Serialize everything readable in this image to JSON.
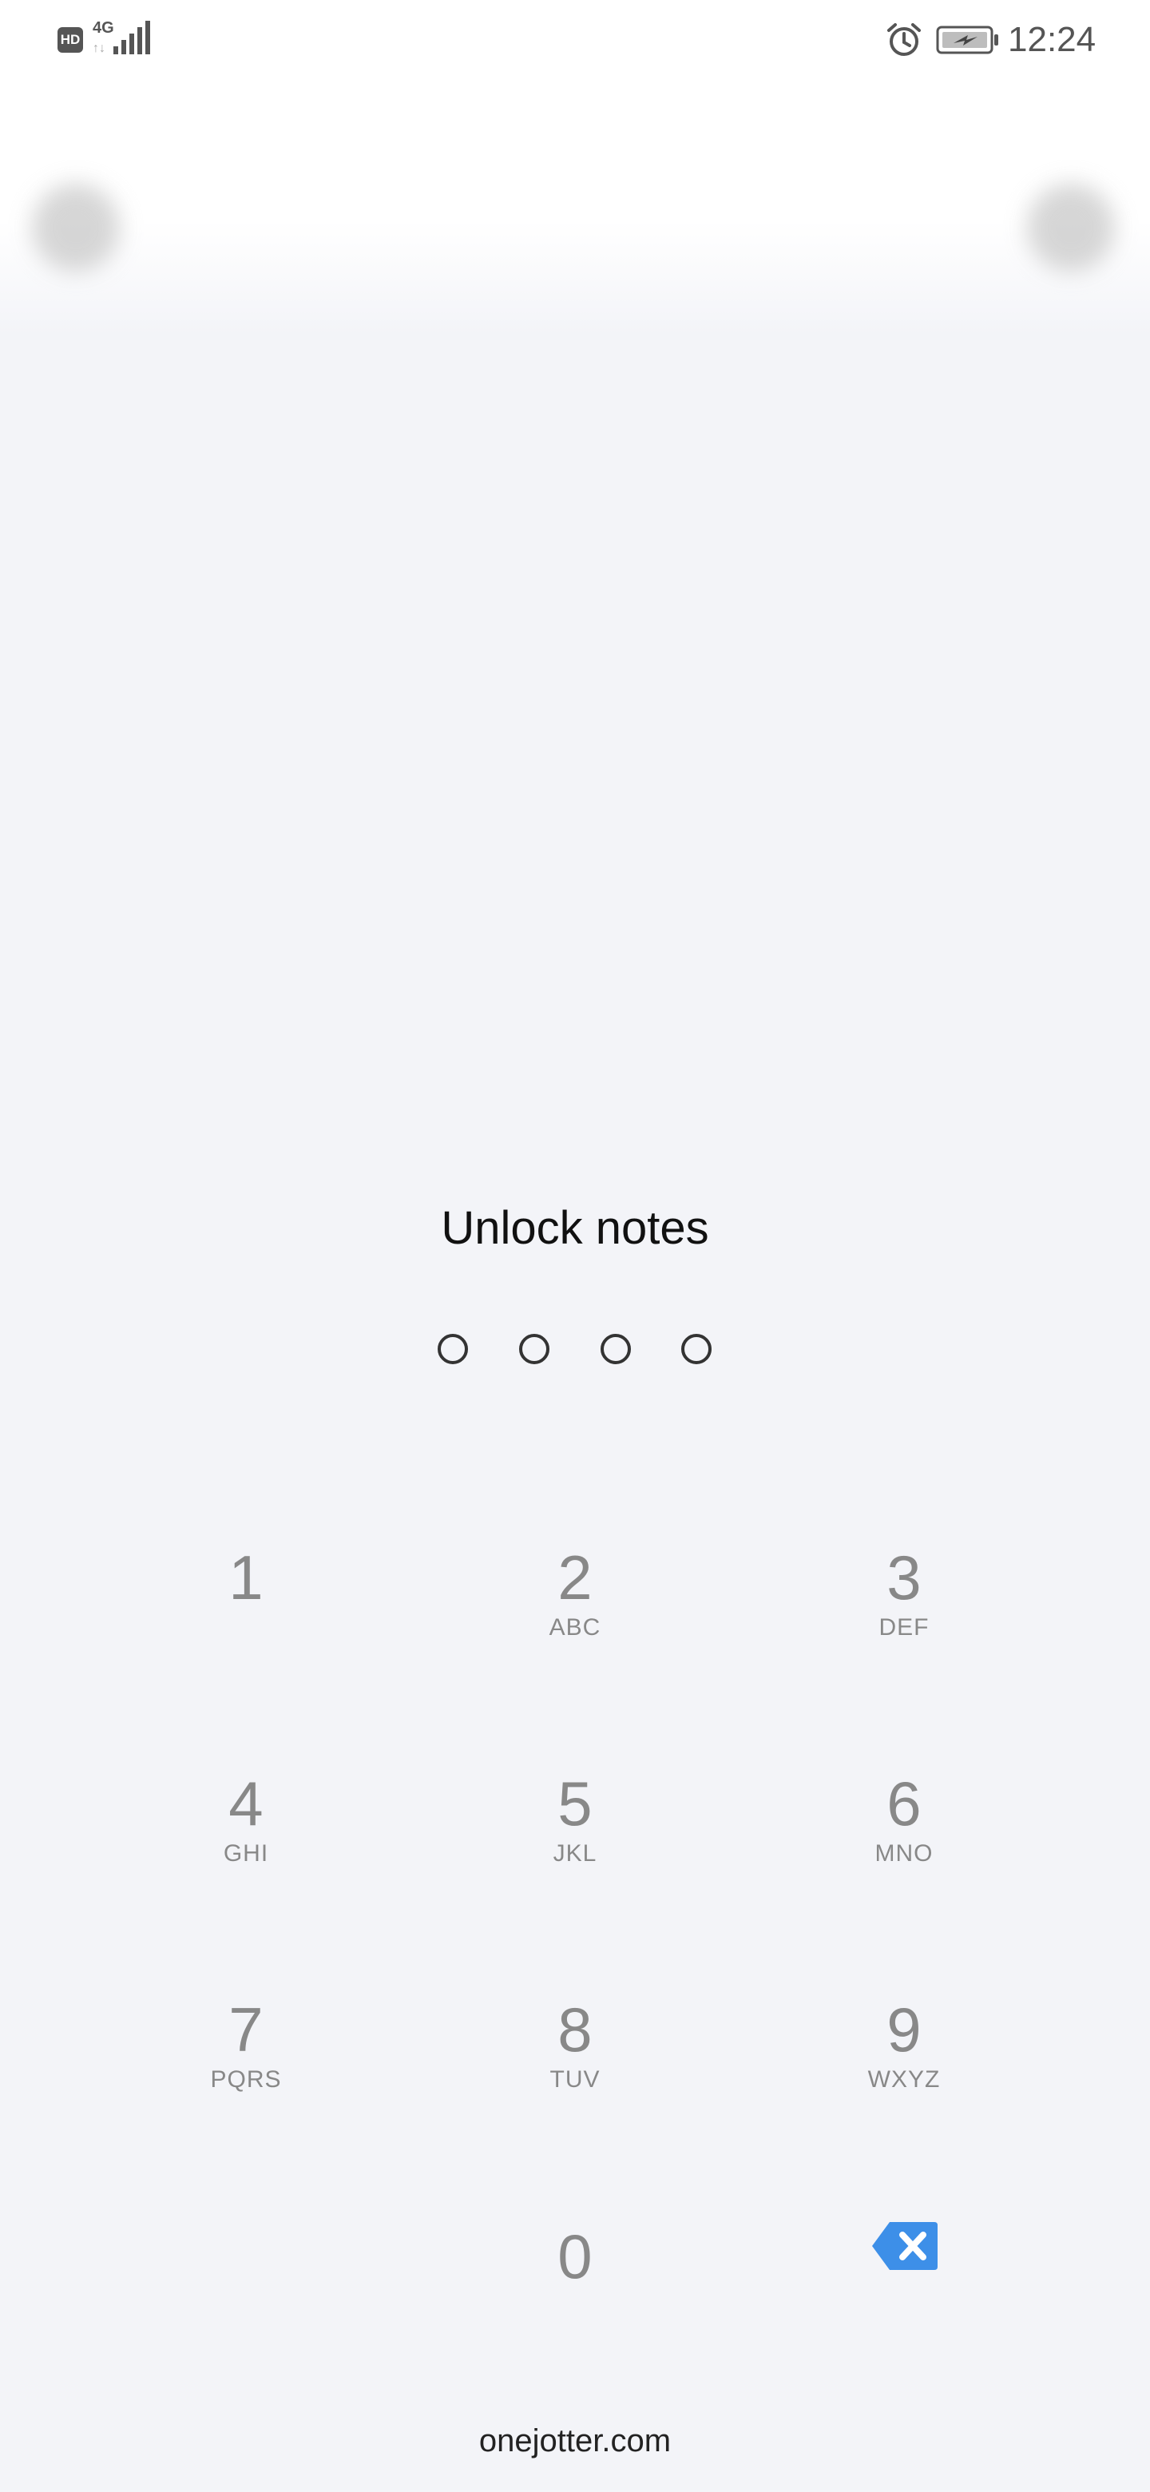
{
  "status_bar": {
    "hd": "HD",
    "network": "4G",
    "network_arrows": "↑↓",
    "time": "12:24"
  },
  "lock": {
    "title": "Unlock notes",
    "pin_length": 4
  },
  "keypad": {
    "keys": [
      {
        "digit": "1",
        "letters": ""
      },
      {
        "digit": "2",
        "letters": "ABC"
      },
      {
        "digit": "3",
        "letters": "DEF"
      },
      {
        "digit": "4",
        "letters": "GHI"
      },
      {
        "digit": "5",
        "letters": "JKL"
      },
      {
        "digit": "6",
        "letters": "MNO"
      },
      {
        "digit": "7",
        "letters": "PQRS"
      },
      {
        "digit": "8",
        "letters": "TUV"
      },
      {
        "digit": "9",
        "letters": "WXYZ"
      },
      {
        "digit": "0",
        "letters": ""
      }
    ],
    "backspace_icon": "backspace-icon"
  },
  "colors": {
    "background": "#f3f4f8",
    "accent": "#3d8fe8"
  },
  "footer": {
    "text": "onejotter.com"
  }
}
